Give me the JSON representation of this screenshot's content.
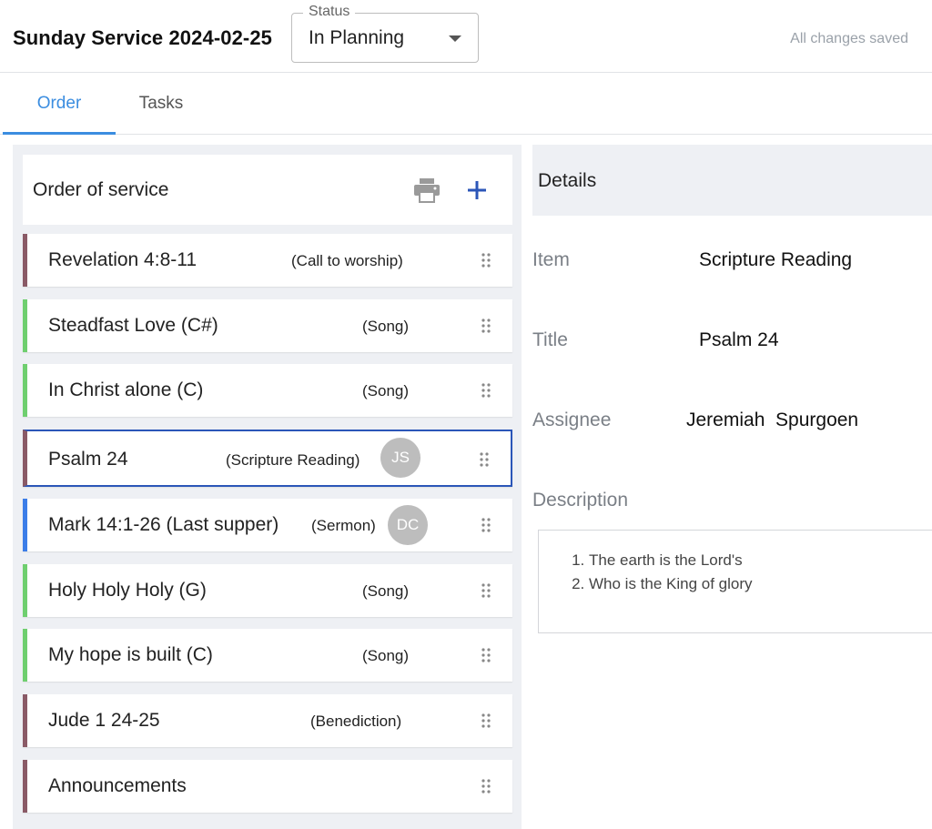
{
  "header": {
    "title": "Sunday Service 2024-02-25",
    "status_label": "Status",
    "status_value": "In Planning",
    "save_state": "All changes saved"
  },
  "tabs": [
    {
      "label": "Order",
      "active": true
    },
    {
      "label": "Tasks",
      "active": false
    }
  ],
  "order_panel": {
    "title": "Order of service",
    "print_icon": "printer-icon",
    "add_icon": "plus-icon",
    "items": [
      {
        "title": "Revelation 4:8-11",
        "type": "(Call to worship)",
        "assignee_initials": "",
        "accent": "#8a5a66",
        "selected": false
      },
      {
        "title": "Steadfast Love (C#)",
        "type": "(Song)",
        "assignee_initials": "",
        "accent": "#6fcf6f",
        "selected": false
      },
      {
        "title": "In Christ alone (C)",
        "type": "(Song)",
        "assignee_initials": "",
        "accent": "#6fcf6f",
        "selected": false
      },
      {
        "title": "Psalm 24",
        "type": "(Scripture Reading)",
        "assignee_initials": "JS",
        "accent": "#8a5a66",
        "selected": true
      },
      {
        "title": "Mark 14:1-26 (Last supper)",
        "type": "(Sermon)",
        "assignee_initials": "DC",
        "accent": "#3b7de8",
        "selected": false
      },
      {
        "title": "Holy Holy Holy (G)",
        "type": "(Song)",
        "assignee_initials": "",
        "accent": "#6fcf6f",
        "selected": false
      },
      {
        "title": "My hope is built (C)",
        "type": "(Song)",
        "assignee_initials": "",
        "accent": "#6fcf6f",
        "selected": false
      },
      {
        "title": "Jude 1 24-25",
        "type": "(Benediction)",
        "assignee_initials": "",
        "accent": "#8a5a66",
        "selected": false
      },
      {
        "title": "Announcements",
        "type": "",
        "assignee_initials": "",
        "accent": "#8a5a66",
        "selected": false
      }
    ]
  },
  "details": {
    "title": "Details",
    "item_label": "Item",
    "item_value": "Scripture Reading",
    "title_label": "Title",
    "title_value": "Psalm 24",
    "assignee_label": "Assignee",
    "assignee_value": "Jeremiah  Spurgoen",
    "description_label": "Description",
    "description_items": [
      "The earth is the Lord's",
      "Who is the King of glory"
    ]
  },
  "colors": {
    "accent_blue": "#3b8de0",
    "selected_border": "#2b56b8",
    "panel_bg": "#eef0f4"
  }
}
